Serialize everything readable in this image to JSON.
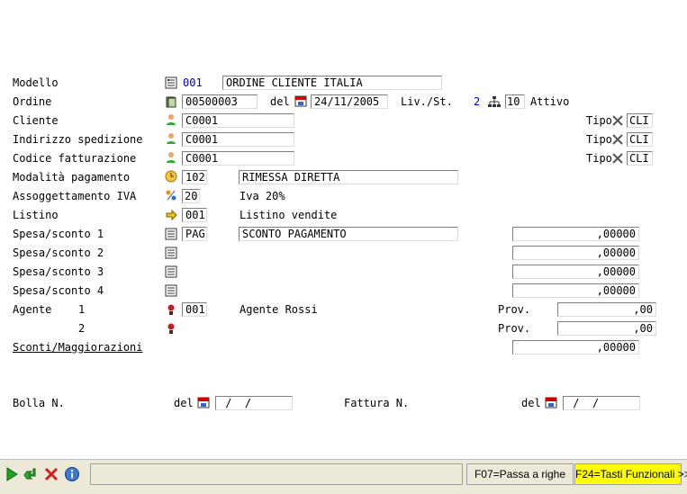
{
  "form": {
    "modello": {
      "label": "Modello",
      "code": "001",
      "desc": "ORDINE CLIENTE ITALIA"
    },
    "ordine": {
      "label": "Ordine",
      "number": "00500003",
      "del_label": "del",
      "date": "24/11/2005",
      "livst_label": "Liv./St.",
      "liv_value": "2",
      "st_value": "10",
      "status": "Attivo"
    },
    "cliente": {
      "label": "Cliente",
      "code": "C0001",
      "tipo_label": "Tipo",
      "tipo_value": "CLI"
    },
    "indirizzo": {
      "label": "Indirizzo spedizione",
      "code": "C0001",
      "tipo_label": "Tipo",
      "tipo_value": "CLI"
    },
    "codice_fatt": {
      "label": "Codice fatturazione",
      "code": "C0001",
      "tipo_label": "Tipo",
      "tipo_value": "CLI"
    },
    "pagamento": {
      "label": "Modalità pagamento",
      "code": "102",
      "desc": "RIMESSA DIRETTA"
    },
    "iva": {
      "label": "Assoggettamento IVA",
      "code": "20",
      "desc": "Iva 20%"
    },
    "listino": {
      "label": "Listino",
      "code": "001",
      "desc": "Listino vendite"
    },
    "spese": [
      {
        "label": "Spesa/sconto 1",
        "code": "PAG",
        "desc": "SCONTO PAGAMENTO",
        "amount": ",00000"
      },
      {
        "label": "Spesa/sconto 2",
        "code": "",
        "desc": "",
        "amount": ",00000"
      },
      {
        "label": "Spesa/sconto 3",
        "code": "",
        "desc": "",
        "amount": ",00000"
      },
      {
        "label": "Spesa/sconto 4",
        "code": "",
        "desc": "",
        "amount": ",00000"
      }
    ],
    "agente1": {
      "label": "Agente",
      "num": "1",
      "code": "001",
      "desc": "Agente Rossi",
      "prov_label": "Prov.",
      "prov": ",00"
    },
    "agente2": {
      "num": "2",
      "prov_label": "Prov.",
      "prov": ",00"
    },
    "sconti": {
      "label": "Sconti/Maggiorazioni",
      "amount": ",00000"
    },
    "bolla": {
      "label": "Bolla N.",
      "del_label": "del",
      "date": " /  /"
    },
    "fattura": {
      "label": "Fattura N.",
      "del_label": "del",
      "date": " /  /"
    }
  },
  "statusbar": {
    "f07": "F07=Passa a righe",
    "f24": "F24=Tasti Funzionali >>"
  },
  "colors": {
    "f24_bg": "#ffff00",
    "code_blue": "#0000cc",
    "statusbar_bg": "#ece9d8"
  }
}
